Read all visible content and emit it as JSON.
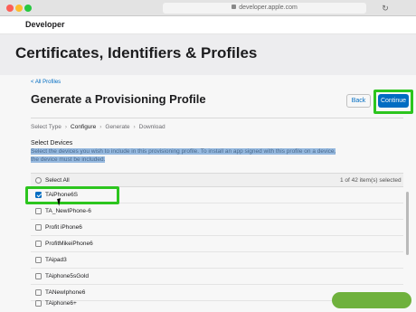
{
  "browser": {
    "url": "developer.apple.com"
  },
  "header": {
    "brand": "Developer"
  },
  "page": {
    "title": "Certificates, Identifiers & Profiles",
    "back_link": "< All Profiles",
    "section_title": "Generate a Provisioning Profile",
    "back_button": "Back",
    "continue_button": "Continue",
    "steps": [
      "Select Type",
      "Configure",
      "Generate",
      "Download"
    ],
    "active_step": "Configure",
    "select_devices_label": "Select Devices",
    "select_devices_desc": "Select the devices you wish to include in this provisioning profile. To install an app signed with this profile on a device, the device must be included."
  },
  "device_list": {
    "select_all_label": "Select All",
    "count_text": "1 of 42 item(s) selected",
    "items": [
      {
        "label": "TAiPhone6S",
        "checked": true
      },
      {
        "label": "TA_NewIPhone-6",
        "checked": false
      },
      {
        "label": "Profit iPhone6",
        "checked": false
      },
      {
        "label": "ProfitMikeiPhone6",
        "checked": false
      },
      {
        "label": "TAipad3",
        "checked": false
      },
      {
        "label": "TAiphone5sGold",
        "checked": false
      },
      {
        "label": "TANewIphone6",
        "checked": false
      },
      {
        "label": "TAiphone6+",
        "checked": false
      }
    ]
  },
  "colors": {
    "accent": "#0070c9",
    "highlight": "#2ecc1f",
    "watermark": "#6fb13d"
  },
  "watermark": {
    "text": "wikiHow"
  }
}
